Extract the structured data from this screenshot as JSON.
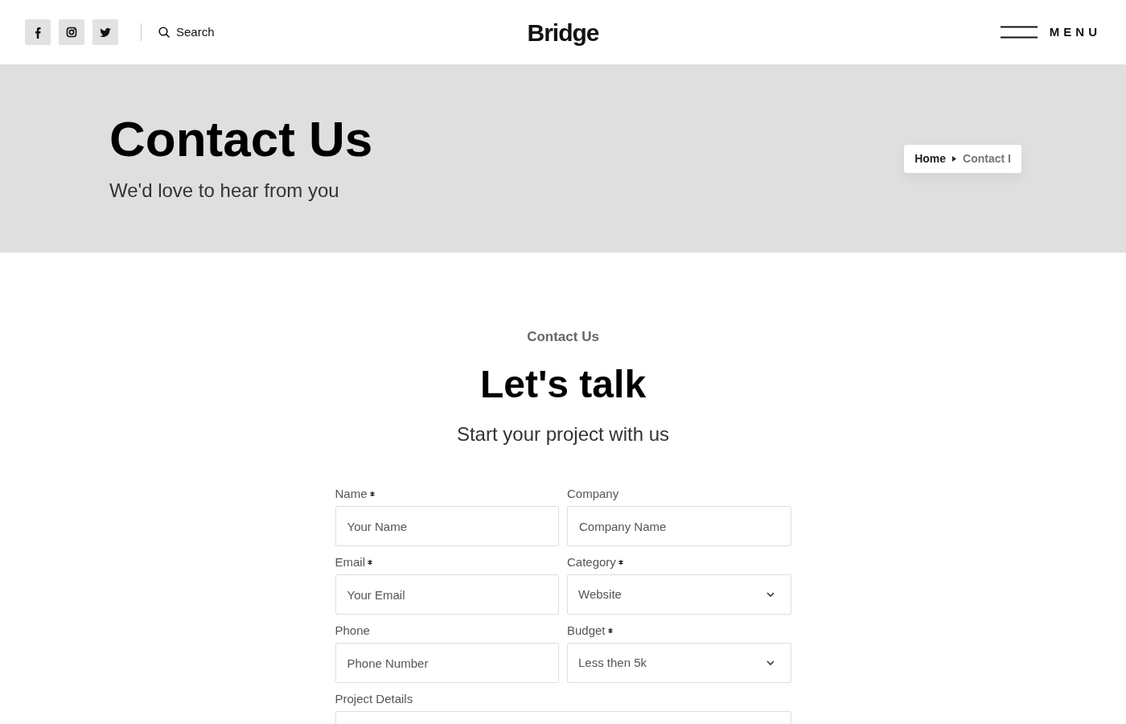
{
  "header": {
    "social": [
      {
        "kind": "facebook"
      },
      {
        "kind": "instagram"
      },
      {
        "kind": "twitter"
      }
    ],
    "search_label": "Search",
    "logo": "Bridge",
    "menu_label": "MENU"
  },
  "hero": {
    "title": "Contact Us",
    "subtitle": "We'd love to hear from you",
    "breadcrumb": [
      {
        "label": "Home",
        "current": false
      },
      {
        "label": "Contact I",
        "current": true
      }
    ]
  },
  "section": {
    "eyebrow": "Contact Us",
    "heading": "Let's talk",
    "subheading": "Start your project with us"
  },
  "form": {
    "fields": [
      {
        "label": "Name",
        "required": true,
        "kind": "input",
        "placeholder": "Your Name"
      },
      {
        "label": "Company",
        "required": false,
        "kind": "input",
        "placeholder": "Company Name"
      },
      {
        "label": "Email",
        "required": true,
        "kind": "input",
        "placeholder": "Your Email"
      },
      {
        "label": "Category",
        "required": true,
        "kind": "select",
        "value": "Website"
      },
      {
        "label": "Phone",
        "required": false,
        "kind": "input",
        "placeholder": "Phone Number"
      },
      {
        "label": "Budget",
        "required": true,
        "kind": "select",
        "value": "Less then 5k"
      },
      {
        "label": "Project Details",
        "required": false,
        "kind": "textarea"
      }
    ]
  }
}
